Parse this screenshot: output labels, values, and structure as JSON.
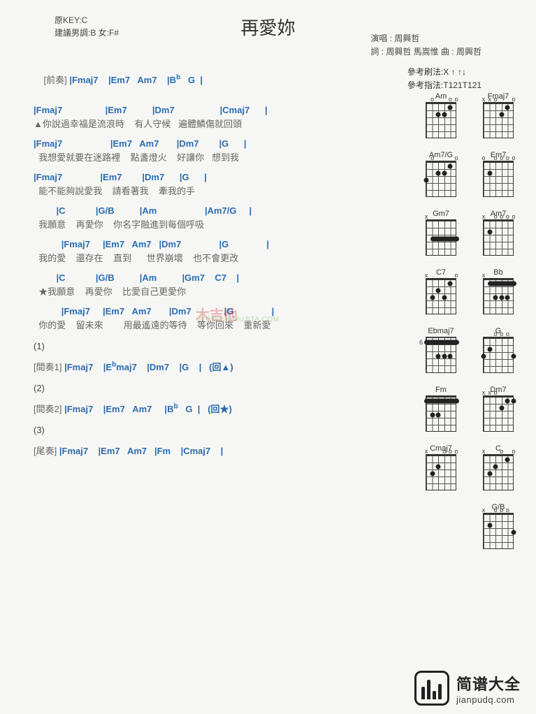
{
  "title": "再愛妳",
  "meta": {
    "original_key": "原KEY:C",
    "suggested": "建議男調:B 女:F#",
    "performer": "演唱 : 周興哲",
    "credits": "詞 : 周興哲 馬嵩惟   曲 : 周興哲"
  },
  "patterns": {
    "strum": "參考刷法:X ↑ ↑↓",
    "pick": "參考指法:T121T121"
  },
  "intro": {
    "label": "[前奏]",
    "chords": "|Fmaj7    |Em7   Am7    |B♭   G  |"
  },
  "verse": [
    {
      "chords": "|Fmaj7                 |Em7          |Dm7                  |Cmaj7      |",
      "lyric": "▲你說過幸福是流浪時    有人守候   遍體鱗傷就回頭"
    },
    {
      "chords": "|Fmaj7                   |Em7   Am7       |Dm7        |G      |",
      "lyric": "  我想愛就要在迷路裡    點盞燈火    好讓你   想到我"
    },
    {
      "chords": "|Fmaj7               |Em7        |Dm7      |G      |",
      "lyric": "  能不能夠說愛我    請看著我    牽我的手"
    }
  ],
  "chorus": [
    {
      "chords": "         |C            |G/B          |Am                   |Am7/G     |",
      "lyric": "  我願意    再愛你    你名字融進到每個呼吸"
    },
    {
      "chords": "           |Fmaj7     |Em7   Am7   |Dm7               |G               |",
      "lyric": "  我的愛    還存在    直到      世界崩壞    也不會更改"
    },
    {
      "chords": "         |C            |G/B          |Am          |Gm7    C7    |",
      "lyric": "  ★我願意    再愛你    比愛自己更愛你"
    },
    {
      "chords": "           |Fmaj7     |Em7   Am7       |Dm7             |G               |",
      "lyric": "  你的愛    留未來        用最遙遠的等待    等你回來    重新愛"
    }
  ],
  "breaks": [
    {
      "num": "(1)",
      "label": "[間奏1]",
      "chords": "|Fmaj7    |E♭maj7    |Dm7    |G    |   (回▲)"
    },
    {
      "num": "(2)",
      "label": "[間奏2]",
      "chords": "|Fmaj7    |Em7   Am7     |B♭   G  |   (回★)"
    },
    {
      "num": "(3)",
      "label": "[尾奏]",
      "chords": "|Fmaj7    |Em7   Am7   |Fm    |Cmaj7    |"
    }
  ],
  "chord_diagrams": [
    {
      "name": "Am",
      "muted": [],
      "open": [
        1,
        2,
        5
      ],
      "dots": [
        [
          2,
          1
        ],
        [
          3,
          2
        ],
        [
          4,
          2
        ]
      ],
      "fret": ""
    },
    {
      "name": "Fmaj7",
      "muted": [
        5,
        6
      ],
      "open": [
        1,
        4
      ],
      "dots": [
        [
          2,
          1
        ],
        [
          3,
          2
        ]
      ],
      "fret": ""
    },
    {
      "name": "Am7/G",
      "muted": [],
      "open": [
        1,
        5
      ],
      "dots": [
        [
          2,
          1
        ],
        [
          3,
          2
        ],
        [
          4,
          2
        ],
        [
          6,
          3
        ]
      ],
      "fret": ""
    },
    {
      "name": "Em7",
      "muted": [],
      "open": [
        1,
        2,
        3,
        4,
        6
      ],
      "dots": [
        [
          5,
          2
        ]
      ],
      "fret": ""
    },
    {
      "name": "Gm7",
      "muted": [
        6
      ],
      "open": [],
      "barre": {
        "fret": 3,
        "from": 1,
        "to": 5
      },
      "dots": [],
      "fret": ""
    },
    {
      "name": "Am7",
      "muted": [
        6
      ],
      "open": [
        1,
        2,
        3,
        4
      ],
      "dots": [
        [
          5,
          2
        ]
      ],
      "fret": ""
    },
    {
      "name": "C7",
      "muted": [
        6
      ],
      "open": [
        1
      ],
      "dots": [
        [
          2,
          1
        ],
        [
          3,
          3
        ],
        [
          4,
          2
        ],
        [
          5,
          3
        ]
      ],
      "fret": ""
    },
    {
      "name": "Bb",
      "muted": [
        6
      ],
      "open": [],
      "barre": {
        "fret": 1,
        "from": 1,
        "to": 5
      },
      "dots": [
        [
          2,
          3
        ],
        [
          3,
          3
        ],
        [
          4,
          3
        ]
      ],
      "fret": ""
    },
    {
      "name": "Ebmaj7",
      "muted": [],
      "open": [],
      "barre": {
        "fret": 1,
        "from": 1,
        "to": 6
      },
      "dots": [
        [
          2,
          3
        ],
        [
          3,
          3
        ],
        [
          4,
          3
        ]
      ],
      "fret": "6"
    },
    {
      "name": "G",
      "muted": [],
      "open": [
        2,
        3,
        4
      ],
      "dots": [
        [
          1,
          3
        ],
        [
          5,
          2
        ],
        [
          6,
          3
        ]
      ],
      "fret": ""
    },
    {
      "name": "Fm",
      "muted": [],
      "open": [],
      "barre": {
        "fret": 1,
        "from": 1,
        "to": 6
      },
      "dots": [
        [
          4,
          3
        ],
        [
          5,
          3
        ]
      ],
      "fret": ""
    },
    {
      "name": "Dm7",
      "muted": [
        5,
        6
      ],
      "open": [
        4
      ],
      "dots": [
        [
          1,
          1
        ],
        [
          2,
          1
        ],
        [
          3,
          2
        ]
      ],
      "fret": ""
    },
    {
      "name": "Cmaj7",
      "muted": [
        6
      ],
      "open": [
        1,
        2,
        3
      ],
      "dots": [
        [
          4,
          2
        ],
        [
          5,
          3
        ]
      ],
      "fret": ""
    },
    {
      "name": "C",
      "muted": [
        6
      ],
      "open": [
        1,
        3
      ],
      "dots": [
        [
          2,
          1
        ],
        [
          4,
          2
        ],
        [
          5,
          3
        ]
      ],
      "fret": ""
    },
    {
      "name": "G/B",
      "muted": [
        6
      ],
      "open": [
        2,
        3,
        4
      ],
      "dots": [
        [
          1,
          3
        ],
        [
          5,
          2
        ]
      ],
      "fret": ""
    }
  ],
  "footer": {
    "cn": "简谱大全",
    "en": "jianpudq.com"
  },
  "watermark": {
    "main": "木吉他",
    "sub": "WWW.MUMUJITA.COM"
  }
}
